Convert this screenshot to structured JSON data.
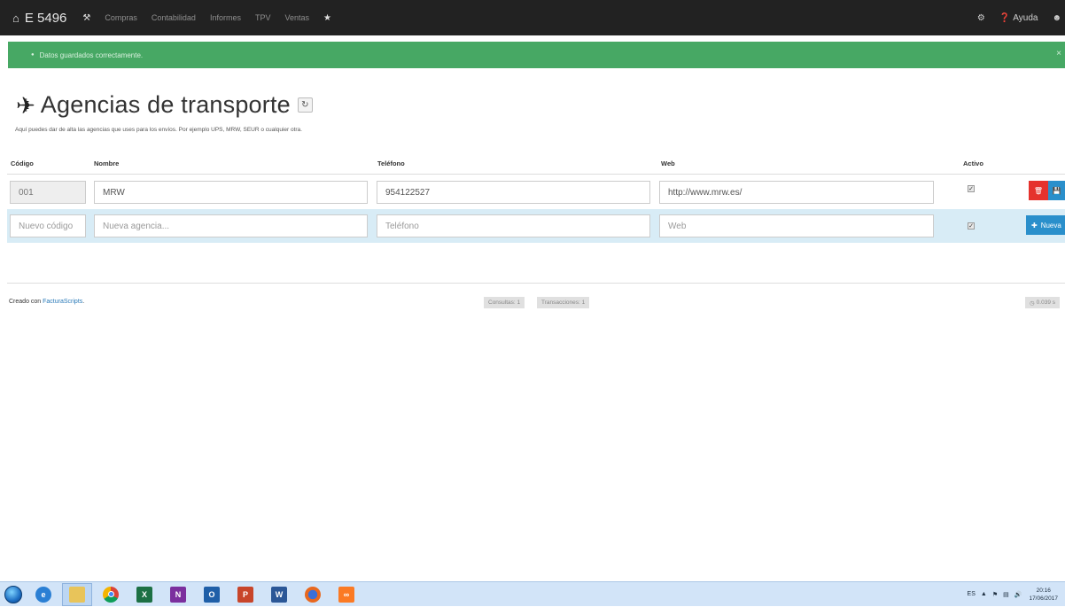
{
  "navbar": {
    "brand": "E 5496",
    "items": [
      "Compras",
      "Contabilidad",
      "Informes",
      "TPV",
      "Ventas"
    ],
    "help": "Ayuda"
  },
  "alert": {
    "message": "Datos guardados correctamente.",
    "close": "×"
  },
  "page": {
    "title": "Agencias de transporte",
    "subtitle": "Aquí puedes dar de alta las agencias que uses para los envíos. Por ejemplo UPS, MRW, SEUR o cualquier otra."
  },
  "table": {
    "headers": {
      "codigo": "Código",
      "nombre": "Nombre",
      "telefono": "Teléfono",
      "web": "Web",
      "activo": "Activo"
    },
    "row": {
      "codigo": "001",
      "nombre": "MRW",
      "telefono": "954122527",
      "web": "http://www.mrw.es/",
      "activo": true
    },
    "new_row": {
      "codigo_placeholder": "Nuevo código",
      "nombre_placeholder": "Nueva agencia...",
      "telefono_placeholder": "Teléfono",
      "web_placeholder": "Web",
      "button": "Nueva"
    }
  },
  "footer": {
    "credit_prefix": "Creado con ",
    "credit_link": "FacturaScripts",
    "credit_suffix": ".",
    "consultas": "Consultas: 1",
    "transacciones": "Transacciones: 1",
    "time": "0.039 s"
  },
  "taskbar": {
    "apps": [
      "internet-explorer",
      "file-explorer",
      "chrome",
      "excel",
      "onenote",
      "outlook",
      "powerpoint",
      "word",
      "firefox",
      "xampp"
    ],
    "tray_lang": "ES",
    "clock_time": "20:16",
    "clock_date": "17/06/2017"
  },
  "colors": {
    "navbar": "#222222",
    "alert": "#47a864",
    "new_row": "#d8ecf6",
    "danger": "#e5322d",
    "primary": "#2a8fcb"
  }
}
